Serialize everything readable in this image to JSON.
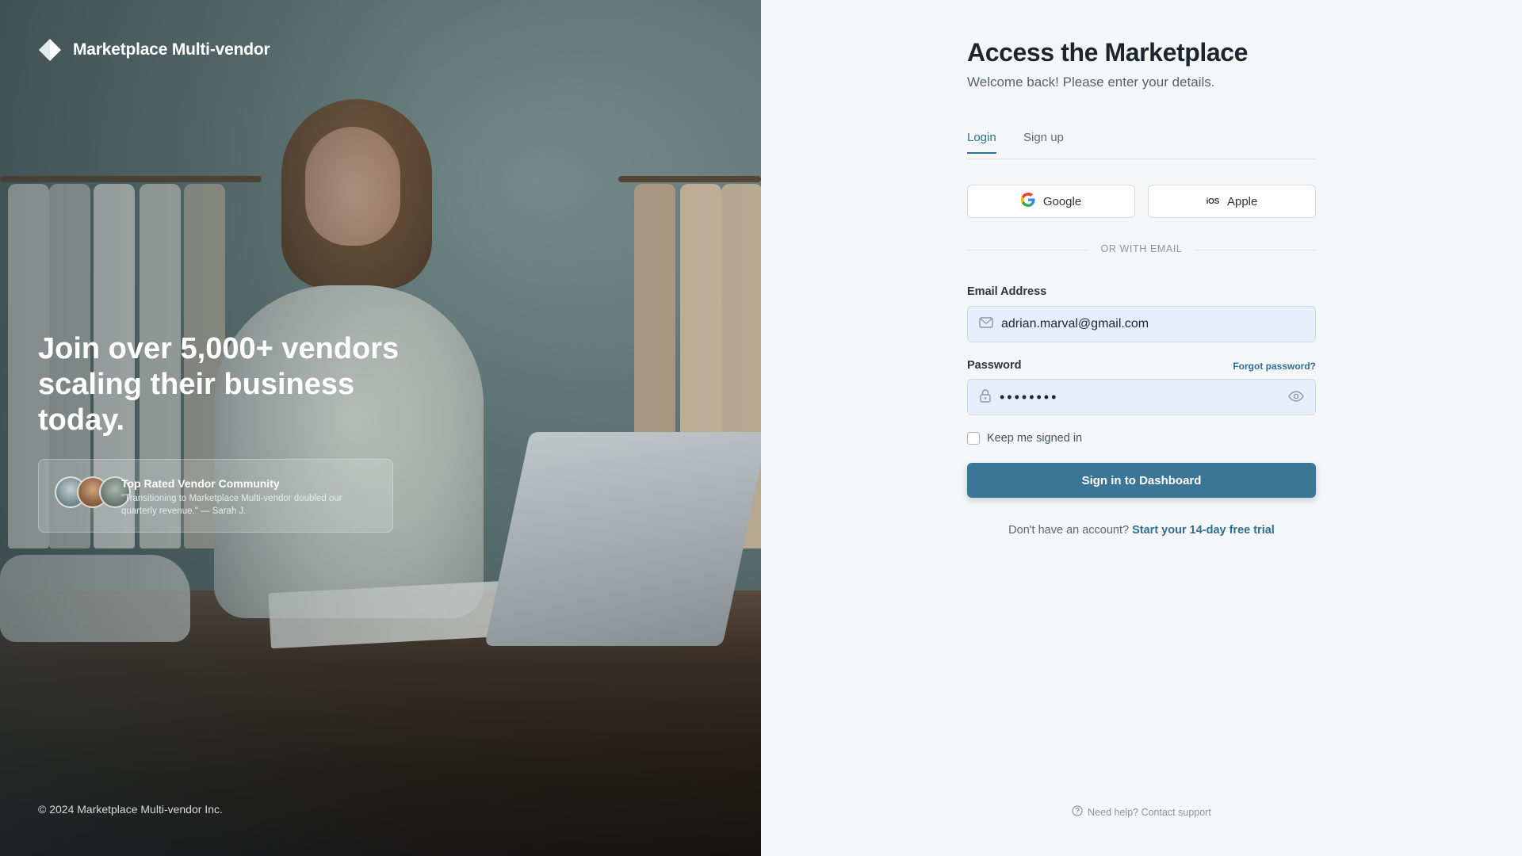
{
  "brand": {
    "name": "Marketplace Multi-vendor",
    "icon": "diamond-logo-icon"
  },
  "hero": {
    "headline": "Join over 5,000+ vendors scaling their business today.",
    "testimonial": {
      "title": "Top Rated Vendor Community",
      "quote": "\"Transitioning to Marketplace Multi-vendor doubled our quarterly revenue.\" — Sarah J."
    },
    "copyright": "© 2024 Marketplace Multi-vendor Inc."
  },
  "form": {
    "title": "Access the Marketplace",
    "subtitle": "Welcome back! Please enter your details.",
    "tabs": [
      {
        "label": "Login",
        "active": true
      },
      {
        "label": "Sign up",
        "active": false
      }
    ],
    "social": {
      "google": "Google",
      "apple_mark": "iOS",
      "apple": "Apple"
    },
    "divider": "OR WITH EMAIL",
    "email": {
      "label": "Email Address",
      "value": "adrian.marval@gmail.com",
      "icon": "mail-icon"
    },
    "password": {
      "label": "Password",
      "value": "••••••••",
      "forgot": "Forgot password?",
      "icon": "lock-icon",
      "toggle_icon": "eye-icon"
    },
    "remember": "Keep me signed in",
    "submit": "Sign in to Dashboard",
    "signup_prompt": "Don't have an account?",
    "signup_link": "Start your 14-day free trial",
    "help": "Need help? Contact support"
  },
  "colors": {
    "accent": "#3b7697",
    "link": "#2f6f93",
    "input_bg": "#e7eefa",
    "panel_bg": "#f4f6f8"
  }
}
